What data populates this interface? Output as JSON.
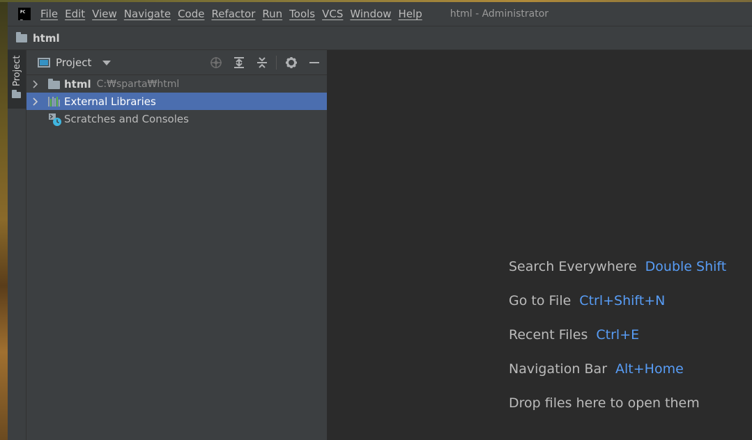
{
  "menubar": {
    "items": [
      "File",
      "Edit",
      "View",
      "Navigate",
      "Code",
      "Refactor",
      "Run",
      "Tools",
      "VCS",
      "Window",
      "Help"
    ],
    "window_title": "html - Administrator"
  },
  "navbar": {
    "label": "html"
  },
  "tool_strip": {
    "label": "Project"
  },
  "project_panel": {
    "title": "Project",
    "tree": [
      {
        "label": "html",
        "path": "C:₩sparta₩html"
      },
      {
        "label": "External Libraries"
      },
      {
        "label": "Scratches and Consoles"
      }
    ]
  },
  "editor": {
    "hints": [
      {
        "text": "Search Everywhere",
        "key": "Double Shift"
      },
      {
        "text": "Go to File",
        "key": "Ctrl+Shift+N"
      },
      {
        "text": "Recent Files",
        "key": "Ctrl+E"
      },
      {
        "text": "Navigation Bar",
        "key": "Alt+Home"
      },
      {
        "text": "Drop files here to open them",
        "key": ""
      }
    ]
  },
  "colors": {
    "accent": "#589df6",
    "selection": "#4b6eaf",
    "panel": "#3c3f41",
    "editor": "#2b2b2b"
  }
}
